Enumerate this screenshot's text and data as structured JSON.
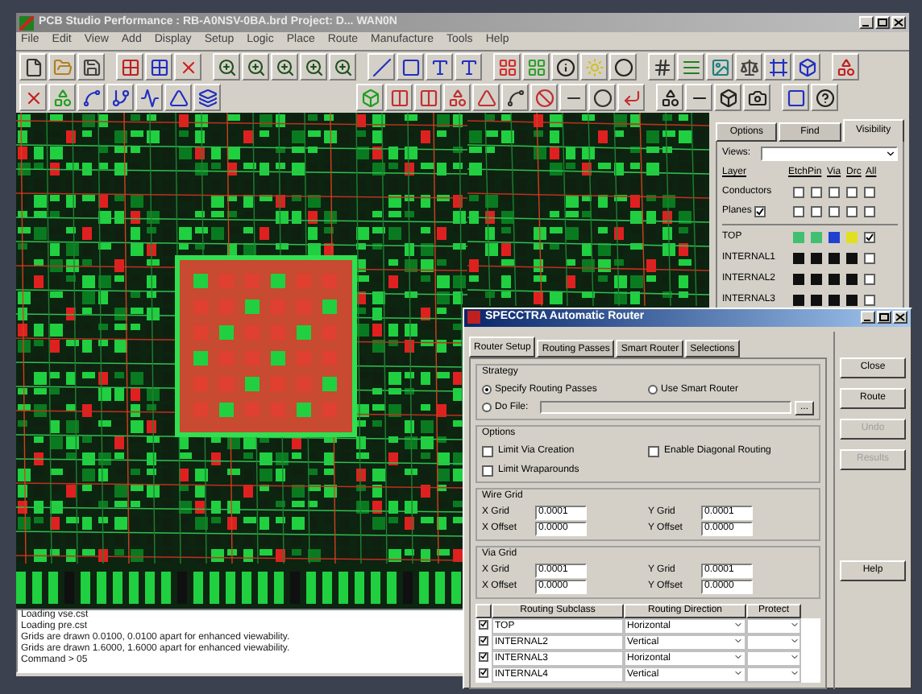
{
  "window": {
    "title": "PCB Studio Performance : RB-A0NSV-0BA.brd  Project: D...  WAN0N"
  },
  "menu": [
    "File",
    "Edit",
    "View",
    "Add",
    "Display",
    "Setup",
    "Logic",
    "Place",
    "Route",
    "Manufacture",
    "Tools",
    "Help"
  ],
  "visibility_panel": {
    "tabs": [
      {
        "label": "Options",
        "selected": false
      },
      {
        "label": "Find",
        "selected": false
      },
      {
        "label": "Visibility",
        "selected": true
      }
    ],
    "views_label": "Views:",
    "columns": [
      "Layer",
      "Etch",
      "Pin",
      "Via",
      "Drc",
      "All"
    ],
    "groups": [
      {
        "kind": "plain",
        "label": "Conductors",
        "boxes": [
          false,
          false,
          false,
          false,
          false
        ]
      },
      {
        "kind": "toggle",
        "label": "Planes",
        "checked": true,
        "boxes": [
          false,
          false,
          false,
          false,
          false
        ]
      }
    ],
    "layers": [
      {
        "name": "TOP",
        "swatches": [
          {
            "color": "#40c070"
          },
          {
            "color": "#40c070"
          },
          {
            "color": "#2040d0"
          },
          {
            "color": "#e0e020"
          }
        ],
        "all": true
      },
      {
        "name": "INTERNAL1",
        "swatches": [
          {
            "color": "#101010"
          },
          {
            "color": "#101010"
          },
          {
            "color": "#101010"
          },
          {
            "color": "#101010"
          }
        ],
        "all": false
      },
      {
        "name": "INTERNAL2",
        "swatches": [
          {
            "color": "#101010"
          },
          {
            "color": "#101010"
          },
          {
            "color": "#101010"
          },
          {
            "color": "#101010"
          }
        ],
        "all": false
      },
      {
        "name": "INTERNAL3",
        "swatches": [
          {
            "color": "#101010"
          },
          {
            "color": "#101010"
          },
          {
            "color": "#101010"
          },
          {
            "color": "#101010"
          }
        ],
        "all": false
      }
    ]
  },
  "log": [
    "Loading vse.cst",
    "Loading pre.cst",
    "Grids are drawn 0.0100, 0.0100 apart for enhanced viewability.",
    "Grids are drawn 1.6000, 1.6000 apart for enhanced viewability.",
    "Command > 05"
  ],
  "router_dialog": {
    "title": "SPECCTRA Automatic Router",
    "tabs": [
      {
        "label": "Router Setup",
        "selected": true
      },
      {
        "label": "Routing Passes",
        "selected": false
      },
      {
        "label": "Smart Router",
        "selected": false
      },
      {
        "label": "Selections",
        "selected": false
      }
    ],
    "strategy": {
      "title": "Strategy",
      "radios": [
        {
          "label": "Specify Routing Passes",
          "selected": true
        },
        {
          "label": "Use Smart Router",
          "selected": false
        },
        {
          "label": "Do File:",
          "selected": false
        }
      ],
      "browse": "..."
    },
    "options": {
      "title": "Options",
      "checks": [
        {
          "label": "Limit Via Creation",
          "checked": false
        },
        {
          "label": "Enable Diagonal Routing",
          "checked": false
        },
        {
          "label": "Limit Wraparounds",
          "checked": false
        }
      ]
    },
    "grids": [
      {
        "title": "Wire Grid",
        "fields": [
          {
            "label": "X Grid",
            "value": "0.0001"
          },
          {
            "label": "Y Grid",
            "value": "0.0001"
          },
          {
            "label": "X Offset",
            "value": "0.0000"
          },
          {
            "label": "Y Offset",
            "value": "0.0000"
          }
        ]
      },
      {
        "title": "Via Grid",
        "fields": [
          {
            "label": "X Grid",
            "value": "0.0001"
          },
          {
            "label": "Y Grid",
            "value": "0.0001"
          },
          {
            "label": "X Offset",
            "value": "0.0000"
          },
          {
            "label": "Y Offset",
            "value": "0.0000"
          }
        ]
      }
    ],
    "table": {
      "columns": [
        "Routing Subclass",
        "Routing Direction",
        "Protect"
      ],
      "rows": [
        {
          "checked": true,
          "subclass": "TOP",
          "direction": "Horizontal"
        },
        {
          "checked": true,
          "subclass": "INTERNAL2",
          "direction": "Vertical"
        },
        {
          "checked": true,
          "subclass": "INTERNAL3",
          "direction": "Horizontal"
        },
        {
          "checked": true,
          "subclass": "INTERNAL4",
          "direction": "Vertical"
        }
      ]
    },
    "buttons": [
      {
        "label": "Close",
        "disabled": false
      },
      {
        "label": "Route",
        "disabled": false
      },
      {
        "label": "Undo",
        "disabled": true
      },
      {
        "label": "Results",
        "disabled": true
      },
      {
        "label": "Help",
        "disabled": false
      }
    ]
  }
}
